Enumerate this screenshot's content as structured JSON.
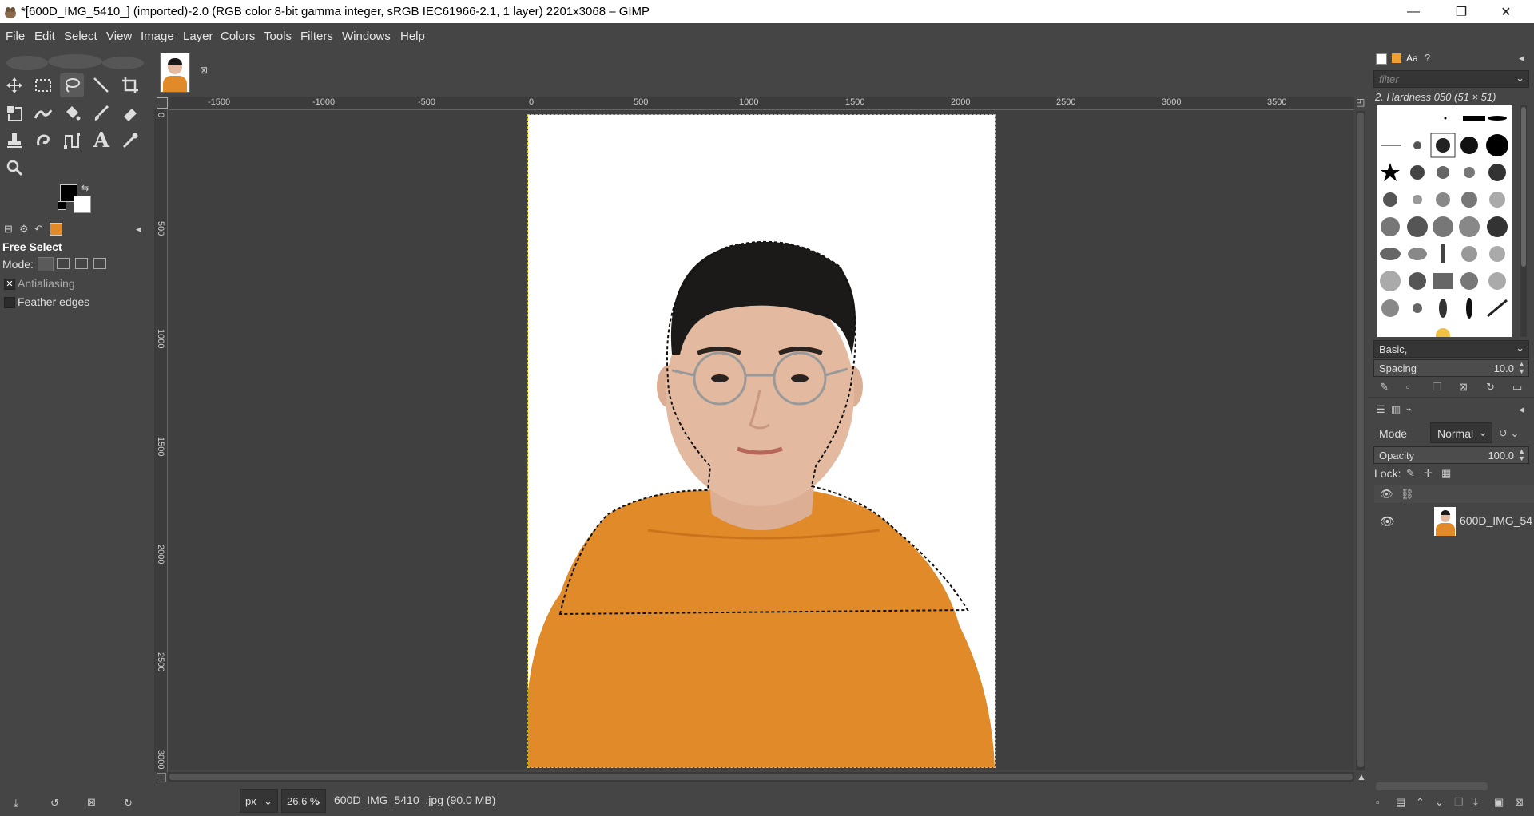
{
  "window": {
    "title": "*[600D_IMG_5410_] (imported)-2.0 (RGB color 8-bit gamma integer, sRGB IEC61966-2.1, 1 layer) 2201x3068 – GIMP",
    "controls": [
      "—",
      "❐",
      "✕"
    ]
  },
  "menu": [
    "File",
    "Edit",
    "Select",
    "View",
    "Image",
    "Layer",
    "Colors",
    "Tools",
    "Filters",
    "Windows",
    "Help"
  ],
  "toolbox": {
    "tools": [
      "move-tool",
      "rect-select-tool",
      "free-select-tool",
      "fuzzy-select-tool",
      "crop-tool",
      "unified-transform-tool",
      "warp-transform-tool",
      "bucket-fill-tool",
      "paintbrush-tool",
      "eraser-tool",
      "clone-tool",
      "smudge-tool",
      "paths-tool",
      "text-tool",
      "color-picker-tool",
      "zoom-tool"
    ],
    "fg_color": "#000000",
    "bg_color": "#ffffff"
  },
  "tool_options": {
    "title": "Free Select",
    "mode_label": "Mode:",
    "antialiasing": {
      "label": "Antialiasing",
      "checked": true
    },
    "feather": {
      "label": "Feather edges",
      "checked": false
    }
  },
  "ruler": {
    "h_labels": [
      "-1500",
      "-1000",
      "-500",
      "0",
      "500",
      "1000",
      "1500",
      "2000",
      "2500",
      "3000",
      "3500"
    ],
    "v_labels": [
      "0",
      "500",
      "1000",
      "1500",
      "2000",
      "2500",
      "3000"
    ]
  },
  "status": {
    "unit": "px",
    "zoom": "26.6 %",
    "file_info": "600D_IMG_5410_.jpg (90.0 MB)"
  },
  "brushes": {
    "filter_placeholder": "filter",
    "selected_brush": "2. Hardness 050 (51 × 51)",
    "preset": "Basic,",
    "spacing_label": "Spacing",
    "spacing_value": "10.0"
  },
  "layers": {
    "mode_label": "Mode",
    "mode_value": "Normal",
    "opacity_label": "Opacity",
    "opacity_value": "100.0",
    "lock_label": "Lock:",
    "layer_name": "600D_IMG_54"
  },
  "colors": {
    "shirt": "#e08a2a",
    "hair": "#1c1a18",
    "skin": "#e3b9a0",
    "selection": "#d9c400"
  }
}
